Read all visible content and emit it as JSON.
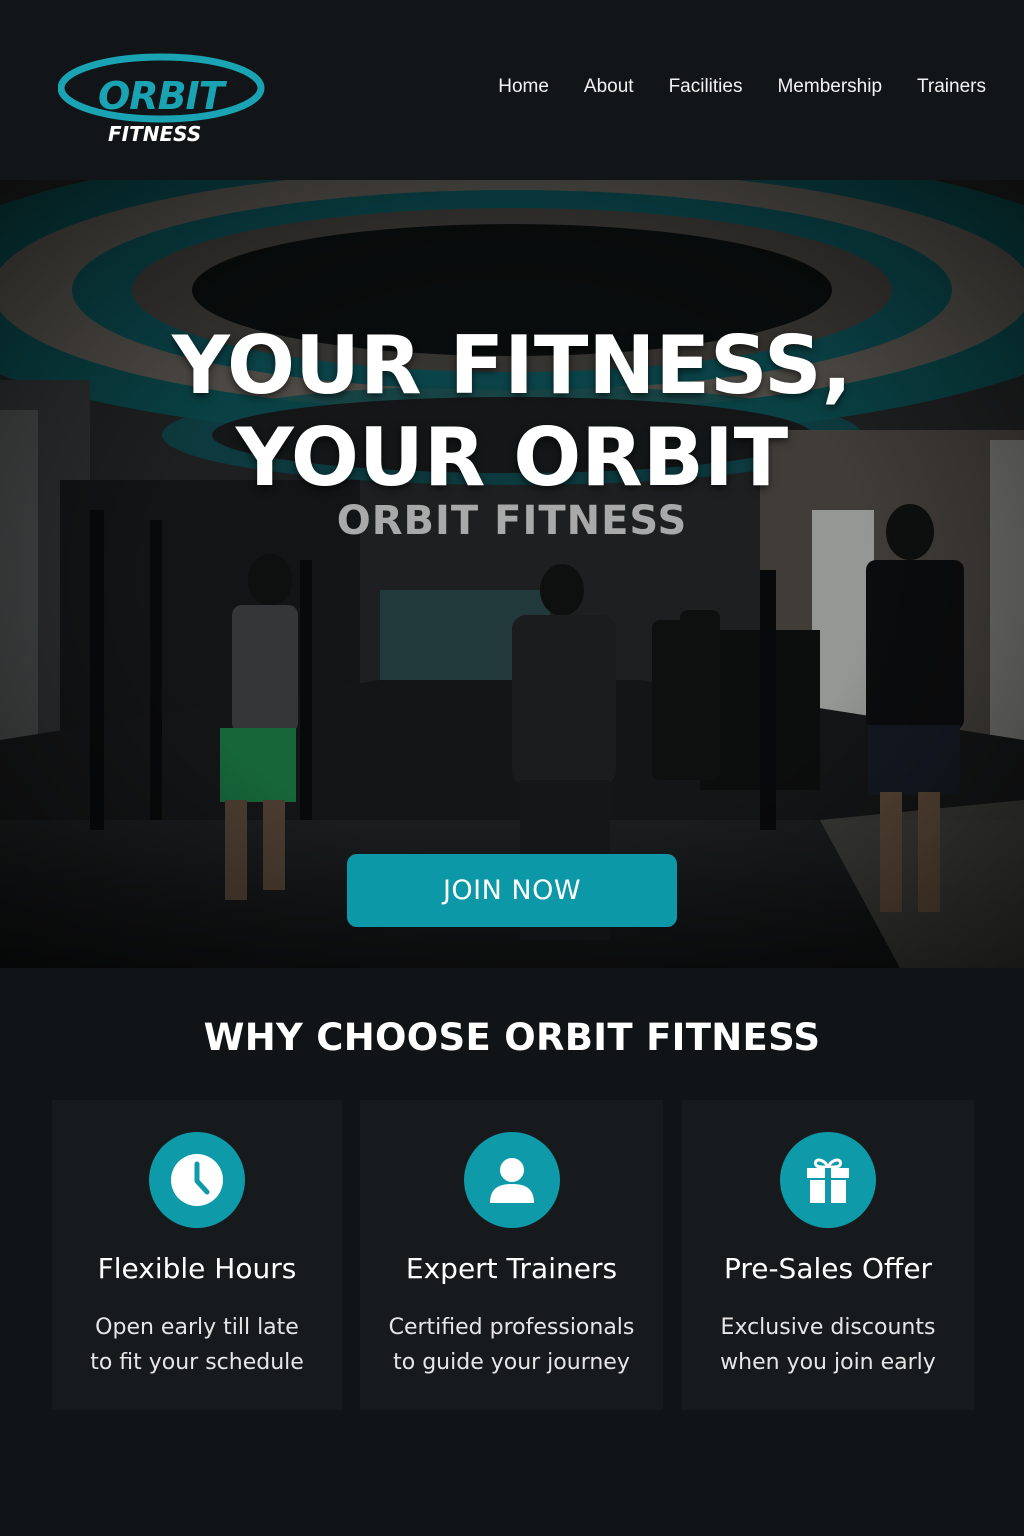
{
  "header": {
    "logo": {
      "line1": "ORBIT",
      "line2": "FITNESS"
    },
    "nav": [
      "Home",
      "About",
      "Facilities",
      "Membership",
      "Trainers"
    ]
  },
  "hero": {
    "title_line1": "YOUR FITNESS,",
    "title_line2": "YOUR ORBIT",
    "subtitle": "ORBIT FITNESS",
    "cta_label": "JOIN NOW"
  },
  "why": {
    "title": "WHY CHOOSE ORBIT FITNESS",
    "cards": [
      {
        "icon": "clock-icon",
        "title": "Flexible Hours",
        "line1": "Open early till late",
        "line2": "to fit your schedule"
      },
      {
        "icon": "user-icon",
        "title": "Expert Trainers",
        "line1": "Certified professionals",
        "line2": "to guide your journey"
      },
      {
        "icon": "gift-icon",
        "title": "Pre-Sales Offer",
        "line1": "Exclusive discounts",
        "line2": "when you join early"
      }
    ]
  },
  "colors": {
    "accent": "#0e9aa8",
    "background": "#111417",
    "card": "#161a1d"
  }
}
